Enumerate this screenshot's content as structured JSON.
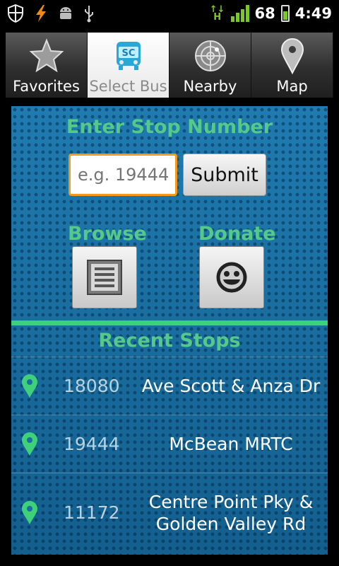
{
  "status_bar": {
    "battery_level": "68",
    "time": "4:49",
    "icons": [
      "shield-icon",
      "lightning-icon",
      "android-icon",
      "usb-icon",
      "hspa-icon",
      "signal-icon",
      "battery-icon"
    ]
  },
  "tabs": [
    {
      "label": "Favorites",
      "icon": "star-icon",
      "active": false
    },
    {
      "label": "Select Bus",
      "icon": "bus-sc-icon",
      "active": true
    },
    {
      "label": "Nearby",
      "icon": "radar-icon",
      "active": false
    },
    {
      "label": "Map",
      "icon": "map-pin-icon",
      "active": false
    }
  ],
  "enter_stop": {
    "title": "Enter Stop Number",
    "placeholder": "e.g. 19444",
    "value": "",
    "submit_label": "Submit"
  },
  "browse": {
    "title": "Browse",
    "icon": "list-icon"
  },
  "donate": {
    "title": "Donate",
    "icon": "smiley-icon"
  },
  "recent": {
    "title": "Recent Stops",
    "stops": [
      {
        "number": "18080",
        "name": "Ave Scott & Anza Dr"
      },
      {
        "number": "19444",
        "name": "McBean MRTC"
      },
      {
        "number": "11172",
        "name": "Centre Point Pky & Golden Valley Rd"
      }
    ]
  },
  "colors": {
    "accent_green": "#55c989",
    "panel_blue": "#1a6fa0",
    "input_focus": "#f39a1a"
  }
}
